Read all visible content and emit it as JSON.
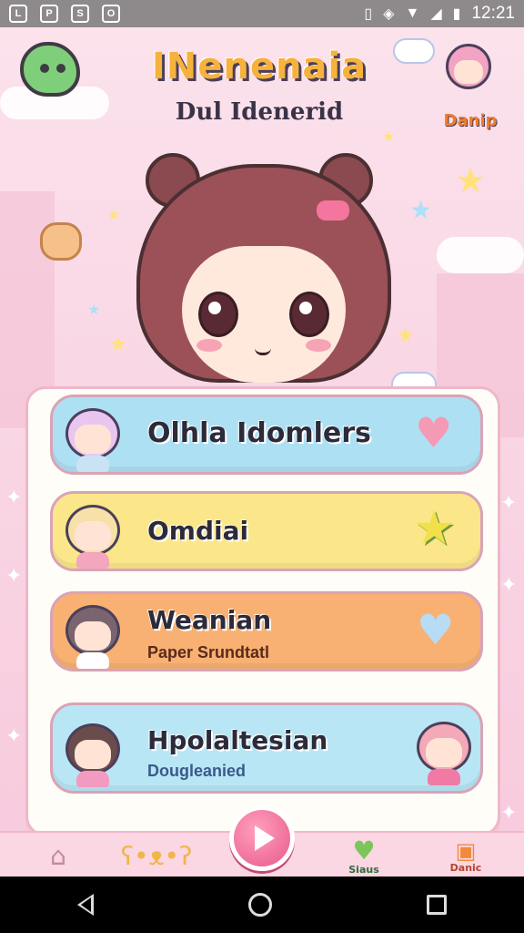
{
  "status_bar": {
    "left_icons": [
      "L",
      "P",
      "S",
      "O"
    ],
    "time": "12:21"
  },
  "header": {
    "title": "INenenaia",
    "subtitle": "Dul Idenerid",
    "profile_label": "Danip"
  },
  "cards": [
    {
      "title": "Olhla Idomlers",
      "subtitle": "",
      "color": "#aee0f4",
      "deco": "heart-icon",
      "deco_color": "#f59ab4"
    },
    {
      "title": "Omdiai",
      "subtitle": "",
      "color": "#fbe78a",
      "deco": "star-icon",
      "deco_color": "#f2e04a"
    },
    {
      "title": "Weanian",
      "subtitle": "Paper Srundtatl",
      "color": "#f8b173",
      "deco": "heart-icon",
      "deco_color": "#b9dcf5"
    },
    {
      "title": "Hpolaltesian",
      "subtitle": "Dougleanied",
      "color": "#b9e6f5",
      "deco": "character-icon",
      "deco_color": "#f4a9b8"
    }
  ],
  "app_nav": {
    "items": [
      {
        "label": "",
        "icon": "home-icon"
      },
      {
        "label": "",
        "icon": "bear-icon"
      },
      {
        "label": "",
        "icon": "play-icon"
      },
      {
        "label": "Siaus",
        "icon": "heart-icon"
      },
      {
        "label": "Danic",
        "icon": "badge-icon"
      }
    ]
  },
  "colors": {
    "accent_pink": "#e85a8a",
    "panel_border": "#efb7c9"
  }
}
